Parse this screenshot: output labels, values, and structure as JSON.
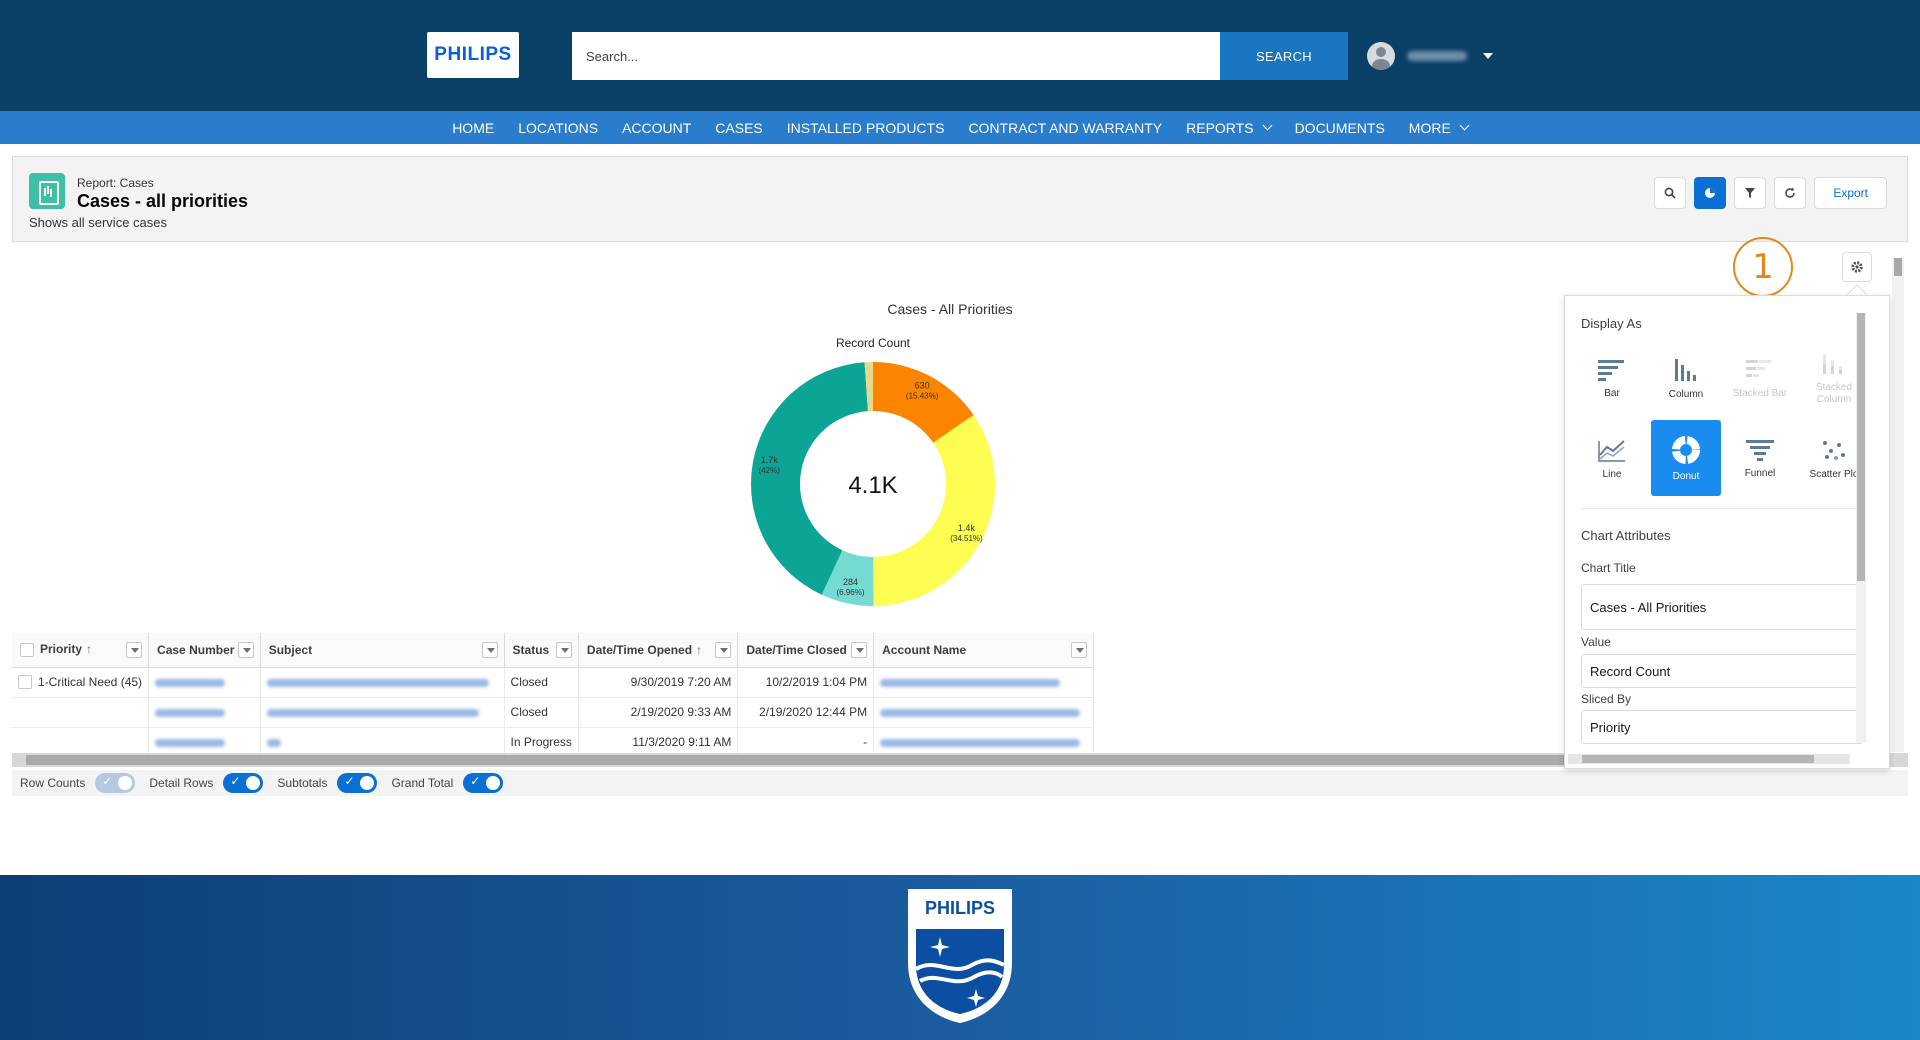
{
  "header": {
    "logo_text": "PHILIPS",
    "search_placeholder": "Search...",
    "search_button": "SEARCH"
  },
  "nav": [
    {
      "label": "HOME"
    },
    {
      "label": "LOCATIONS"
    },
    {
      "label": "ACCOUNT"
    },
    {
      "label": "CASES"
    },
    {
      "label": "INSTALLED PRODUCTS"
    },
    {
      "label": "CONTRACT AND WARRANTY"
    },
    {
      "label": "REPORTS",
      "has_menu": true
    },
    {
      "label": "DOCUMENTS"
    },
    {
      "label": "MORE",
      "has_menu": true
    }
  ],
  "report": {
    "type_label": "Report: Cases",
    "title": "Cases - all priorities",
    "description": "Shows all service cases",
    "export_label": "Export"
  },
  "chart_data": {
    "type": "donut",
    "title": "Cases - All Priorities",
    "value_label": "Record Count",
    "center_label": "4.1K",
    "total": 4100,
    "slices": [
      {
        "label": "630",
        "percent_label": "(15.43%)",
        "percent": 15.43,
        "color": "#fc8500"
      },
      {
        "label": "1.4k",
        "percent_label": "(34.51%)",
        "percent": 34.51,
        "color": "#fdfd52"
      },
      {
        "label": "284",
        "percent_label": "(6.96%)",
        "percent": 6.96,
        "color": "#75dad1"
      },
      {
        "label": "1.7k",
        "percent_label": "(42%)",
        "percent": 42.0,
        "color": "#0ba495"
      },
      {
        "label": "",
        "percent_label": "",
        "percent": 1.1,
        "color": "#e7d88d"
      }
    ]
  },
  "callout": "1",
  "table": {
    "columns": [
      "Priority",
      "Case Number",
      "Subject",
      "Status",
      "Date/Time Opened",
      "Date/Time Closed",
      "Account Name"
    ],
    "group_label": "1-Critical Need (45)",
    "rows": [
      {
        "status": "Closed",
        "opened": "9/30/2019 7:20 AM",
        "closed": "10/2/2019 1:04 PM"
      },
      {
        "status": "Closed",
        "opened": "2/19/2020 9:33 AM",
        "closed": "2/19/2020 12:44 PM"
      },
      {
        "status": "In Progress",
        "opened": "11/3/2020 9:11 AM",
        "closed": "-"
      }
    ]
  },
  "toggles": [
    {
      "label": "Row Counts",
      "on": false
    },
    {
      "label": "Detail Rows",
      "on": true
    },
    {
      "label": "Subtotals",
      "on": true
    },
    {
      "label": "Grand Total",
      "on": true
    }
  ],
  "panel": {
    "display_as_label": "Display As",
    "chart_types": [
      {
        "label": "Bar",
        "icon": "bar-chart-icon",
        "state": "normal"
      },
      {
        "label": "Column",
        "icon": "column-chart-icon",
        "state": "normal"
      },
      {
        "label": "Stacked Bar",
        "icon": "stacked-bar-chart-icon",
        "state": "disabled"
      },
      {
        "label": "Stacked Column",
        "icon": "stacked-column-chart-icon",
        "state": "disabled"
      },
      {
        "label": "Line",
        "icon": "line-chart-icon",
        "state": "normal"
      },
      {
        "label": "Donut",
        "icon": "donut-chart-icon",
        "state": "selected"
      },
      {
        "label": "Funnel",
        "icon": "funnel-chart-icon",
        "state": "normal"
      },
      {
        "label": "Scatter Plo",
        "icon": "scatter-plot-icon",
        "state": "normal"
      }
    ],
    "chart_attributes_label": "Chart Attributes",
    "chart_title_label": "Chart Title",
    "chart_title_value": "Cases - All Priorities",
    "value_label": "Value",
    "value_value": "Record Count",
    "sliced_by_label": "Sliced By",
    "sliced_by_value": "Priority"
  },
  "footer": {
    "logo_text": "PHILIPS"
  },
  "colors": {
    "header_bg": "#0a3f66",
    "nav_bg": "#2a7ccc",
    "accent": "#0b6fd3",
    "callout": "#e08a1e"
  }
}
